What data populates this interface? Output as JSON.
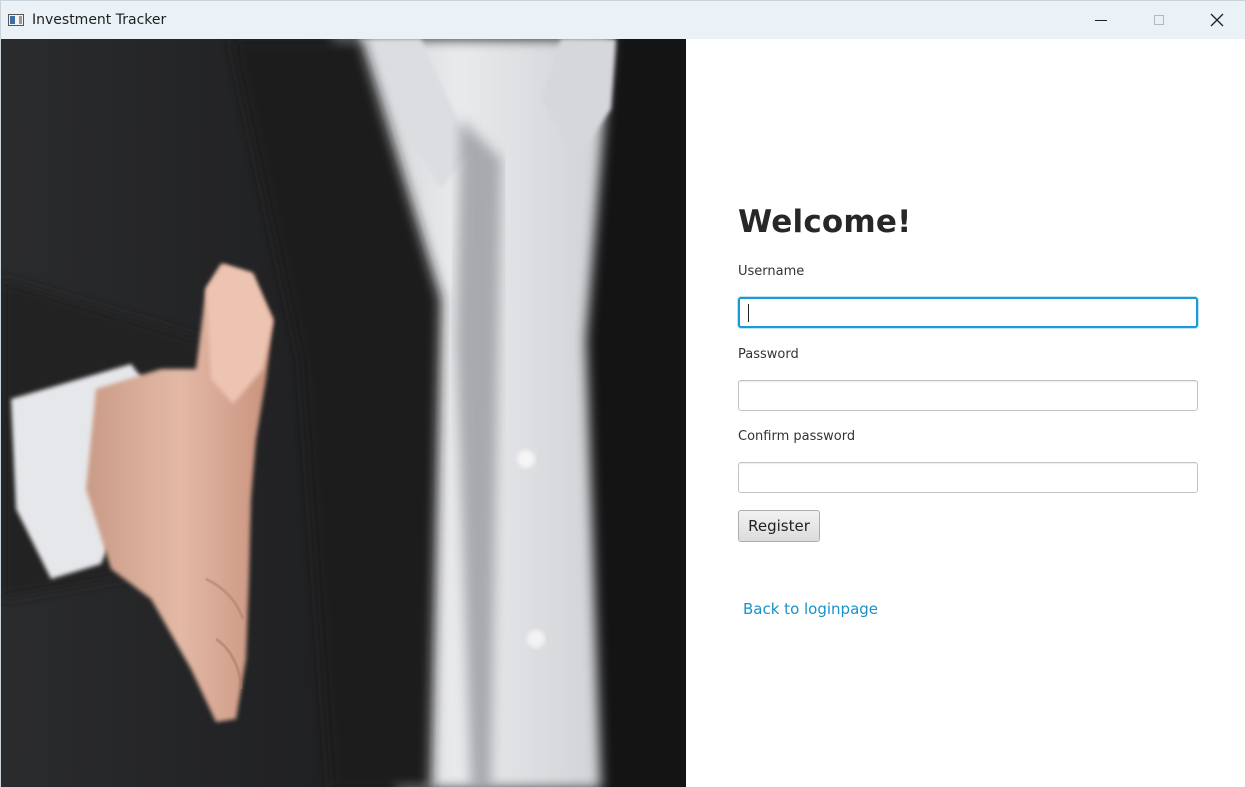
{
  "window": {
    "title": "Investment Tracker",
    "minimize_glyph": "—",
    "maximize_glyph": "□",
    "close_glyph": "✕"
  },
  "photo": {
    "icon": "handshake-photo"
  },
  "form": {
    "heading": "Welcome!",
    "username_label": "Username",
    "username_value": "",
    "password_label": "Password",
    "password_value": "",
    "confirm_label": "Confirm password",
    "confirm_value": "",
    "register_label": "Register",
    "back_link": "Back to loginpage"
  },
  "colors": {
    "accent": "#1a9bd8",
    "link": "#1793c9",
    "heading": "#272727"
  }
}
